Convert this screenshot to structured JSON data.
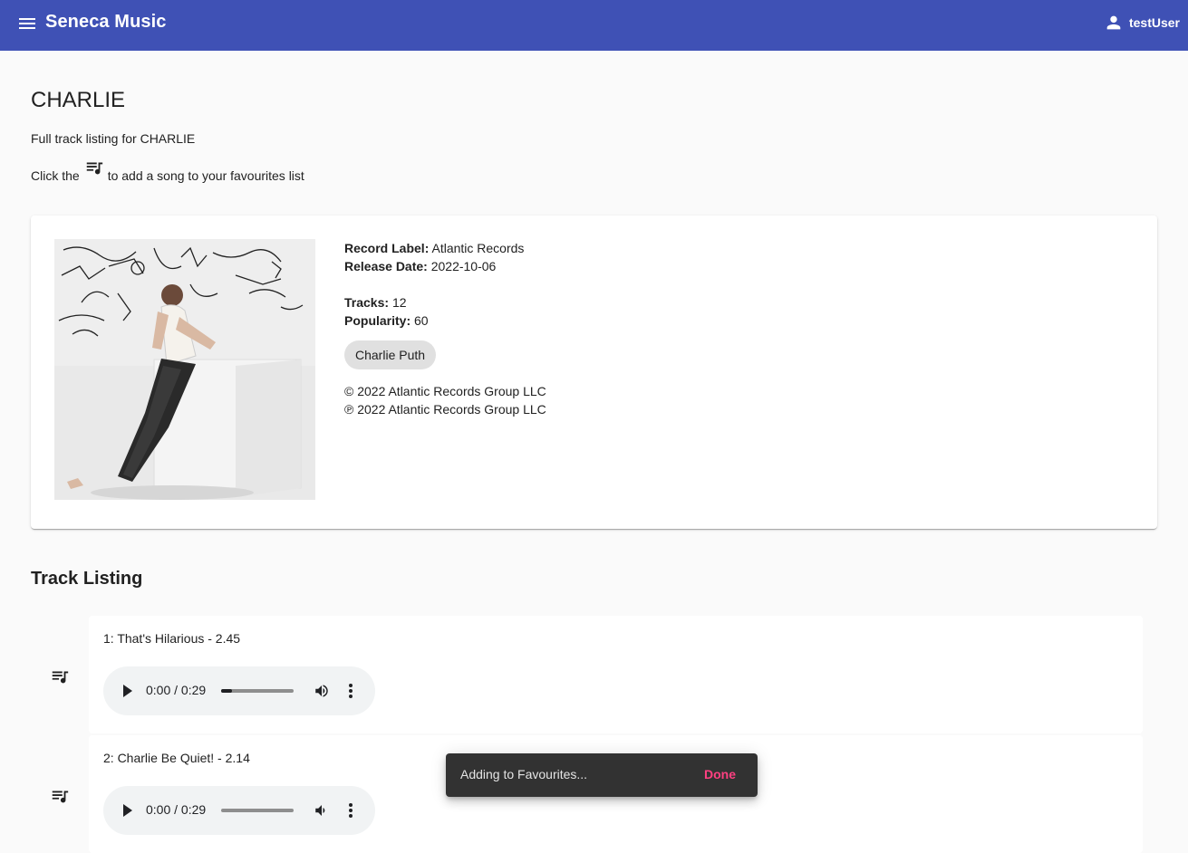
{
  "app": {
    "title": "Seneca Music",
    "user": "testUser"
  },
  "page": {
    "title": "CHARLIE",
    "subtitle": "Full track listing for CHARLIE",
    "hint_before": "Click the",
    "hint_after": "to add a song to your favourites list"
  },
  "album": {
    "record_label_label": "Record Label:",
    "record_label": "Atlantic Records",
    "release_date_label": "Release Date:",
    "release_date": "2022-10-06",
    "tracks_label": "Tracks:",
    "tracks": "12",
    "popularity_label": "Popularity:",
    "popularity": "60",
    "artist": "Charlie Puth",
    "copyright_c": "© 2022 Atlantic Records Group LLC",
    "copyright_p": "℗ 2022 Atlantic Records Group LLC"
  },
  "track_listing": {
    "title": "Track Listing",
    "tracks": [
      {
        "label": "1: That's Hilarious - 2.45",
        "time": "0:00 / 0:29",
        "progress": 0.15
      },
      {
        "label": "2: Charlie Be Quiet! - 2.14",
        "time": "0:00 / 0:29",
        "progress": 0.0
      }
    ]
  },
  "snackbar": {
    "message": "Adding to Favourites...",
    "action": "Done"
  },
  "colors": {
    "primary": "#3f51b5",
    "accent": "#ff4081"
  }
}
